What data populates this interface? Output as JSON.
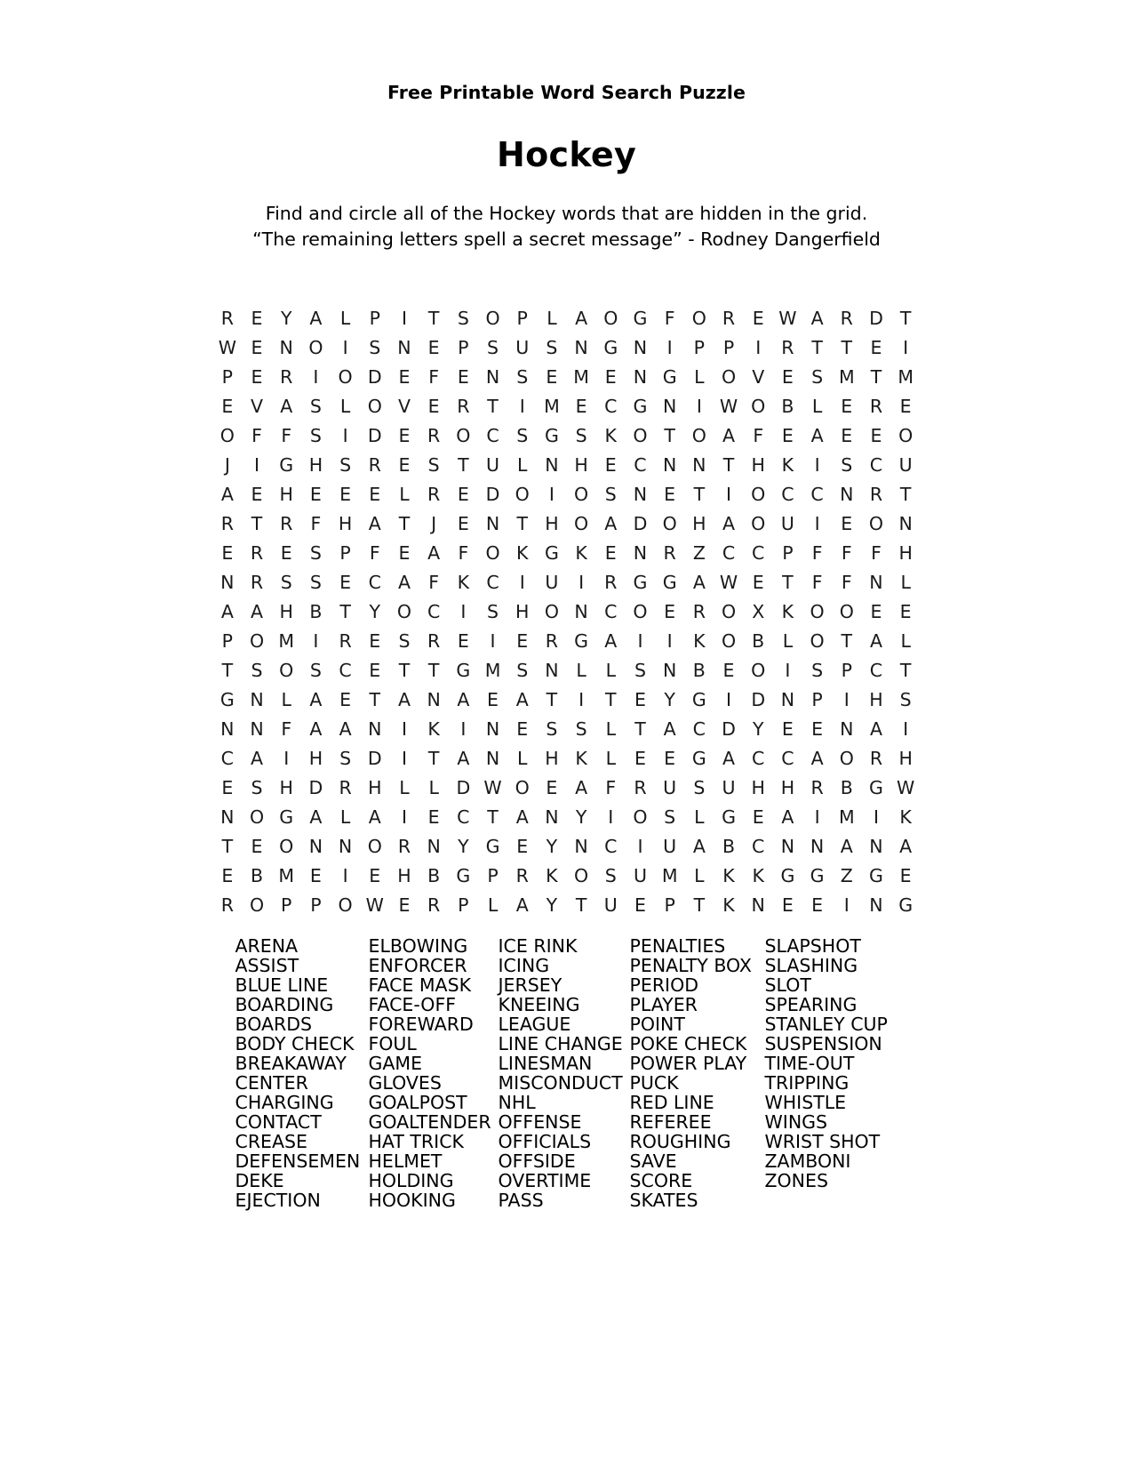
{
  "header": {
    "kicker": "Free Printable Word Search Puzzle",
    "title": "Hockey",
    "instruction_line_1": "Find and circle all of the Hockey words that are hidden in the grid.",
    "instruction_line_2": "“The remaining letters spell a secret message” - Rodney Dangerfield"
  },
  "grid": {
    "rows": 20,
    "cols": 24,
    "letters": [
      "REYALPITSOPLAOGFOREWARDT",
      "WENOISNEPSUSNGNIPPIRTTEI",
      "PERIODEFENSEMENGLOVESMTM",
      "EVASLOVERTIMECGNIWOBLERE",
      "OFFSIDEROCSGSKOTOAFEAEEO",
      "JIGHSRESTULNHECNNTHKISCU",
      "AEHEEELREDOIOSNETIOCCNRT",
      "RTRFHATJENTHOADOHAOUIEON",
      "ERESPFEAFOKGKENRZCCPFFFH",
      "NRSSECAFKCIUIRGGAWETFFNL",
      "AAHBTYOCISHONCOEROXKOOEE",
      "POMIRESREIERGAIIKOBLOTAL",
      "TSOSCETTGMSNLLSNBEOISPCT",
      "GNLAETANAEATITEYGIDNPIHS",
      "NNFAANIKINESSLTACDYEENAI",
      "CAIHSDITANLHKLEEGACCAORH",
      "ESHDRHLLDWOEAFRUSUHHRBGW",
      "NOGALAIECTANYIOSLGEAIMIK",
      "TEONNORNYGEYNCIUABCNNANA",
      "EBMEIEHBGPRKOSUMLKKGGZGE",
      "ROPPOWERPLAYTUEPTKNEEING"
    ]
  },
  "word_list": {
    "columns": [
      [
        "ARENA",
        "ASSIST",
        "BLUE LINE",
        "BOARDING",
        "BOARDS",
        "BODY CHECK",
        "BREAKAWAY",
        "CENTER",
        "CHARGING",
        "CONTACT",
        "CREASE",
        "DEFENSEMEN",
        "DEKE",
        "EJECTION"
      ],
      [
        "ELBOWING",
        "ENFORCER",
        "FACE MASK",
        "FACE-OFF",
        "FOREWARD",
        "FOUL",
        "GAME",
        "GLOVES",
        "GOALPOST",
        "GOALTENDER",
        "HAT TRICK",
        "HELMET",
        "HOLDING",
        "HOOKING"
      ],
      [
        "ICE RINK",
        "ICING",
        "JERSEY",
        "KNEEING",
        "LEAGUE",
        "LINE CHANGE",
        "LINESMAN",
        "MISCONDUCT",
        "NHL",
        "OFFENSE",
        "OFFICIALS",
        "OFFSIDE",
        "OVERTIME",
        "PASS"
      ],
      [
        "PENALTIES",
        "PENALTY BOX",
        "PERIOD",
        "PLAYER",
        "POINT",
        "POKE CHECK",
        "POWER PLAY",
        "PUCK",
        "RED LINE",
        "REFEREE",
        "ROUGHING",
        "SAVE",
        "SCORE",
        "SKATES"
      ],
      [
        "SLAPSHOT",
        "SLASHING",
        "SLOT",
        "SPEARING",
        "STANLEY CUP",
        "SUSPENSION",
        "TIME-OUT",
        "TRIPPING",
        "WHISTLE",
        "WINGS",
        "WRIST SHOT",
        "ZAMBONI",
        "ZONES"
      ]
    ]
  }
}
